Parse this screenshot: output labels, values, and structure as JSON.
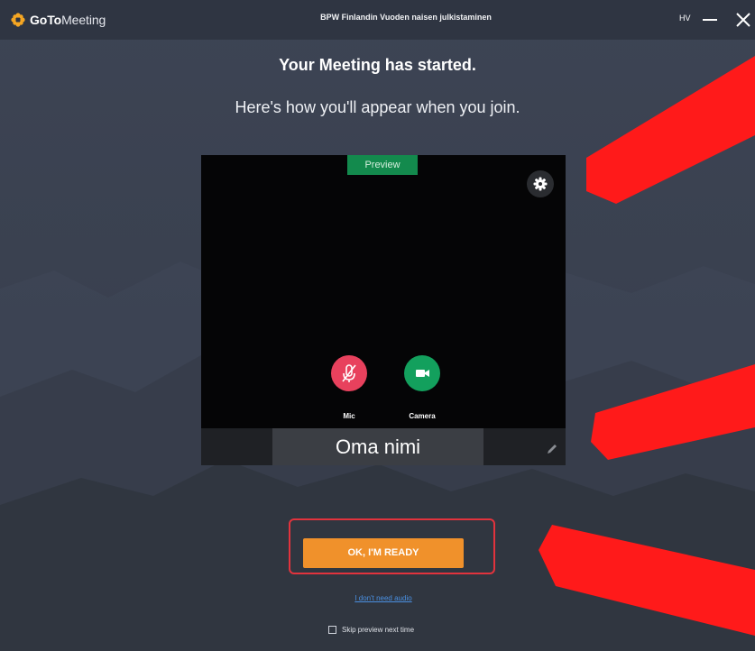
{
  "app": {
    "logo_goto": "GoTo",
    "logo_meeting": "Meeting",
    "window_title": "BPW Finlandin Vuoden naisen julkistaminen",
    "user_initials": "HV"
  },
  "main": {
    "headline": "Your Meeting has started.",
    "subline": "Here's how you'll appear when you join."
  },
  "preview": {
    "tab_label": "Preview",
    "mic_label": "Mic",
    "camera_label": "Camera",
    "name_value": "Oma nimi"
  },
  "actions": {
    "ready_label": "OK, I'M READY",
    "no_audio_link": "I don't need audio",
    "skip_label": "Skip preview next time"
  },
  "colors": {
    "accent_orange": "#f0912b",
    "mic_red": "#e8415d",
    "camera_green": "#13a05d",
    "preview_green": "#138a4d",
    "annotation_red": "#ff1a1a"
  }
}
